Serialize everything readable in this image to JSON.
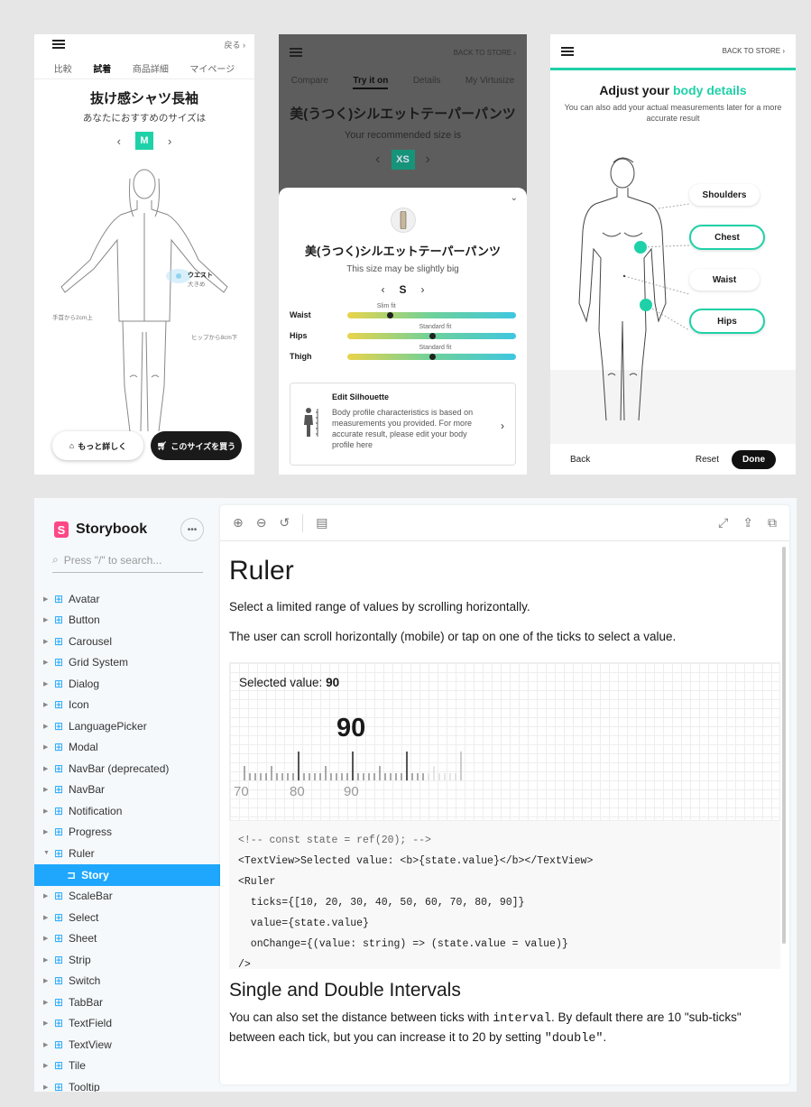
{
  "phone1": {
    "back": "戻る ›",
    "tabs": [
      "比較",
      "試着",
      "商品詳細",
      "マイページ"
    ],
    "active_tab": 1,
    "title": "抜け感シャツ長袖",
    "subtitle": "あなたにおすすめのサイズは",
    "size": "M",
    "waist_label": "ウエスト",
    "waist_note": "大きめ",
    "left_note": "手首から2cm上",
    "right_note": "ヒップから8cm下",
    "more_button": "もっと詳しく",
    "buy_button": "このサイズを買う"
  },
  "phone2": {
    "back": "BACK TO STORE",
    "tabs": [
      "Compare",
      "Try it on",
      "Details",
      "My Virtusize"
    ],
    "active_tab": 1,
    "title": "美(うつく)シルエットテーパーパンツ",
    "subtitle": "Your recommended size is",
    "size": "XS",
    "sheet_title": "美(うつく)シルエットテーパーパンツ",
    "sheet_subtitle": "This size may be slightly big",
    "sheet_size": "S",
    "fits": [
      {
        "name": "Waist",
        "label": "Slim fit",
        "position": 0.25
      },
      {
        "name": "Hips",
        "label": "Standard fit",
        "position": 0.5
      },
      {
        "name": "Thigh",
        "label": "Standard fit",
        "position": 0.5
      }
    ],
    "silhouette_title": "Edit Silhouette",
    "silhouette_desc": "Body profile characteristics is based on measurements you provided. For more accurate result, please edit your body profile here"
  },
  "phone3": {
    "back": "BACK TO STORE",
    "title_a": "Adjust your ",
    "title_b": "body details",
    "subtitle": "You can also add your actual measurements later for a more accurate result",
    "parts": [
      "Shoulders",
      "Chest",
      "Waist",
      "Hips"
    ],
    "back_btn": "Back",
    "reset_btn": "Reset",
    "done_btn": "Done"
  },
  "storybook": {
    "brand": "Storybook",
    "search_placeholder": "Press \"/\" to search...",
    "items": [
      "Avatar",
      "Button",
      "Carousel",
      "Grid System",
      "Dialog",
      "Icon",
      "LanguagePicker",
      "Modal",
      "NavBar (deprecated)",
      "NavBar",
      "Notification",
      "Progress",
      "Ruler"
    ],
    "story": "Story",
    "items_after": [
      "ScaleBar",
      "Select",
      "Sheet",
      "Strip",
      "Switch",
      "TabBar",
      "TextField",
      "TextView",
      "Tile",
      "Tooltip"
    ],
    "doc_title": "Ruler",
    "p1": "Select a limited range of values by scrolling horizontally.",
    "p2": "The user can scroll horizontally (mobile) or tap on one of the ticks to select a value.",
    "selected_label": "Selected value: ",
    "selected_value": "90",
    "tick_labels": [
      "70",
      "80",
      "90"
    ],
    "code": [
      "<!-- const state = ref(20); -->",
      "<TextView>Selected value: <b>{state.value}</b></TextView>",
      "<Ruler",
      "  ticks={[10, 20, 30, 40, 50, 60, 70, 80, 90]}",
      "  value={state.value}",
      "  onChange={(value: string) => (state.value = value)}",
      "/>"
    ],
    "h2": "Single and Double Intervals",
    "p3a": "You can also set the distance between ticks with ",
    "p3code1": "interval",
    "p3b": ". By default there are 10 \"sub-ticks\" between each tick, but you can increase it to 20 by setting ",
    "p3code2": "\"double\"",
    "p3c": "."
  }
}
